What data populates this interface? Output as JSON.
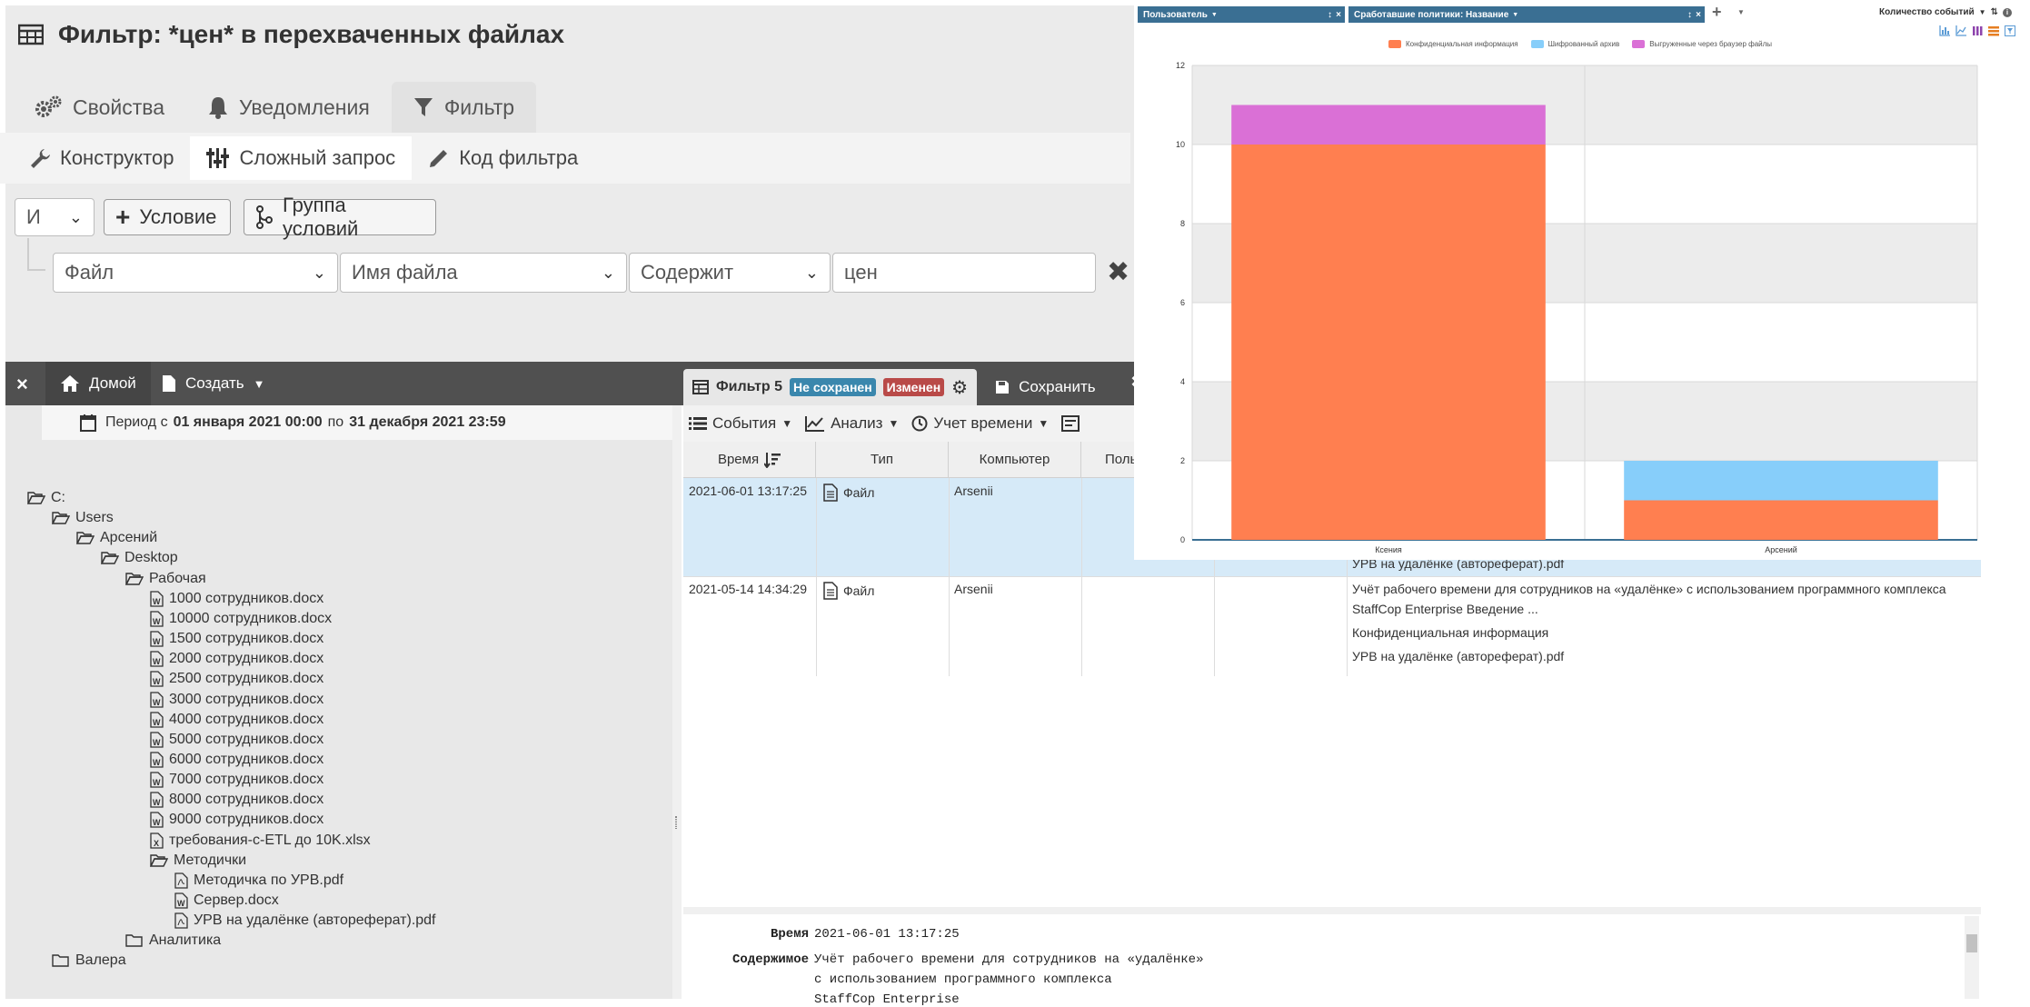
{
  "filter": {
    "title": "Фильтр: *цен* в перехваченных файлах",
    "tabs": [
      {
        "label": "Свойства",
        "active": false
      },
      {
        "label": "Уведомления",
        "active": false
      },
      {
        "label": "Фильтр",
        "active": true
      }
    ],
    "subtabs": [
      {
        "label": "Конструктор",
        "active": false
      },
      {
        "label": "Сложный запрос",
        "active": true
      },
      {
        "label": "Код фильтра",
        "active": false
      }
    ],
    "logic_select": "И",
    "add_condition": "Условие",
    "add_group": "Группа условий",
    "condition": {
      "object": "Файл",
      "field": "Имя файла",
      "operator": "Содержит",
      "value": "цен"
    }
  },
  "topbar": {
    "close": "×",
    "home": "Домой",
    "create": "Создать"
  },
  "period": {
    "prefix": "Период с",
    "from": "01 января 2021 00:00",
    "mid": "по",
    "to": "31 декабря 2021 23:59"
  },
  "tree": [
    {
      "label": "C:",
      "type": "folder-open",
      "depth": 0
    },
    {
      "label": "Users",
      "type": "folder-open",
      "depth": 1
    },
    {
      "label": "Арсений",
      "type": "folder-open",
      "depth": 2
    },
    {
      "label": "Desktop",
      "type": "folder-open",
      "depth": 3
    },
    {
      "label": "Рабочая",
      "type": "folder-open",
      "depth": 4
    },
    {
      "label": "1000 сотрудников.docx",
      "type": "word",
      "depth": 5
    },
    {
      "label": "10000 сотрудников.docx",
      "type": "word",
      "depth": 5
    },
    {
      "label": "1500 сотрудников.docx",
      "type": "word",
      "depth": 5
    },
    {
      "label": "2000 сотрудников.docx",
      "type": "word",
      "depth": 5
    },
    {
      "label": "2500 сотрудников.docx",
      "type": "word",
      "depth": 5
    },
    {
      "label": "3000 сотрудников.docx",
      "type": "word",
      "depth": 5
    },
    {
      "label": "4000 сотрудников.docx",
      "type": "word",
      "depth": 5
    },
    {
      "label": "5000 сотрудников.docx",
      "type": "word",
      "depth": 5
    },
    {
      "label": "6000 сотрудников.docx",
      "type": "word",
      "depth": 5
    },
    {
      "label": "7000 сотрудников.docx",
      "type": "word",
      "depth": 5
    },
    {
      "label": "8000 сотрудников.docx",
      "type": "word",
      "depth": 5
    },
    {
      "label": "9000 сотрудников.docx",
      "type": "word",
      "depth": 5
    },
    {
      "label": "требования-с-ETL до 10K.xlsx",
      "type": "excel",
      "depth": 5
    },
    {
      "label": "Методички",
      "type": "folder-open",
      "depth": 5
    },
    {
      "label": "Методичка по УРВ.pdf",
      "type": "pdf",
      "depth": 6
    },
    {
      "label": "Сервер.docx",
      "type": "word",
      "depth": 6
    },
    {
      "label": "УРВ на удалёнке (автореферат).pdf",
      "type": "pdf",
      "depth": 6
    },
    {
      "label": "Аналитика",
      "type": "folder",
      "depth": 4
    },
    {
      "label": "Валера",
      "type": "folder",
      "depth": 1
    }
  ],
  "events": {
    "tab_title": "Фильтр 5",
    "badge_unsaved": "Не сохранен",
    "badge_changed": "Изменен",
    "save": "Сохранить",
    "toolbar": [
      "События",
      "Анализ",
      "Учет времени"
    ],
    "columns": [
      "Время",
      "Тип",
      "Компьютер",
      "Поль"
    ],
    "rows": [
      {
        "time": "2021-06-01 13:17:25",
        "type": "Файл",
        "computer": "Arsenii",
        "details": [
          "УРВ на удалёнке (автореферат).pdf"
        ]
      },
      {
        "time": "2021-05-14 14:34:29",
        "type": "Файл",
        "computer": "Arsenii",
        "details": [
          "Учёт рабочего времени для сотрудников на «удалёнке» с использованием программного комплекса",
          "StaffCop Enterprise Введение ...",
          "Конфиденциальная информация",
          "УРВ на удалёнке (автореферат).pdf"
        ]
      }
    ],
    "detail": {
      "time_label": "Время",
      "time_value": "2021-06-01 13:17:25",
      "content_label": "Содержимое",
      "content_lines": [
        "Учёт рабочего времени для сотрудников на «удалёнке»",
        "с использованием программного комплекса",
        "StaffCop Enterprise"
      ]
    }
  },
  "chart_header": {
    "chip_user": "Пользователь",
    "chip_policy": "Сработавшие политики: Название",
    "chip_close": "×",
    "plus": "+",
    "metric": "Количество событий"
  },
  "chart_data": {
    "type": "bar",
    "stacked": true,
    "categories": [
      "Ксения",
      "Арсений"
    ],
    "series": [
      {
        "name": "Конфиденциальная информация",
        "color": "#ff7f50",
        "values": [
          10,
          1
        ]
      },
      {
        "name": "Шифрованный архив",
        "color": "#87cefa",
        "values": [
          0,
          1
        ]
      },
      {
        "name": "Выгруженные через браузер файлы",
        "color": "#da70d6",
        "values": [
          1,
          0
        ]
      }
    ],
    "ylim": [
      0,
      12
    ],
    "yticks": [
      0,
      2,
      4,
      6,
      8,
      10,
      12
    ],
    "grid": true,
    "legend_position": "top"
  },
  "colors": {
    "badge_unsaved": "#3a87ad",
    "badge_changed": "#b94a48",
    "topbar": "#505050",
    "chip": "#3a6f93",
    "selected_row": "#d6eaf8"
  }
}
